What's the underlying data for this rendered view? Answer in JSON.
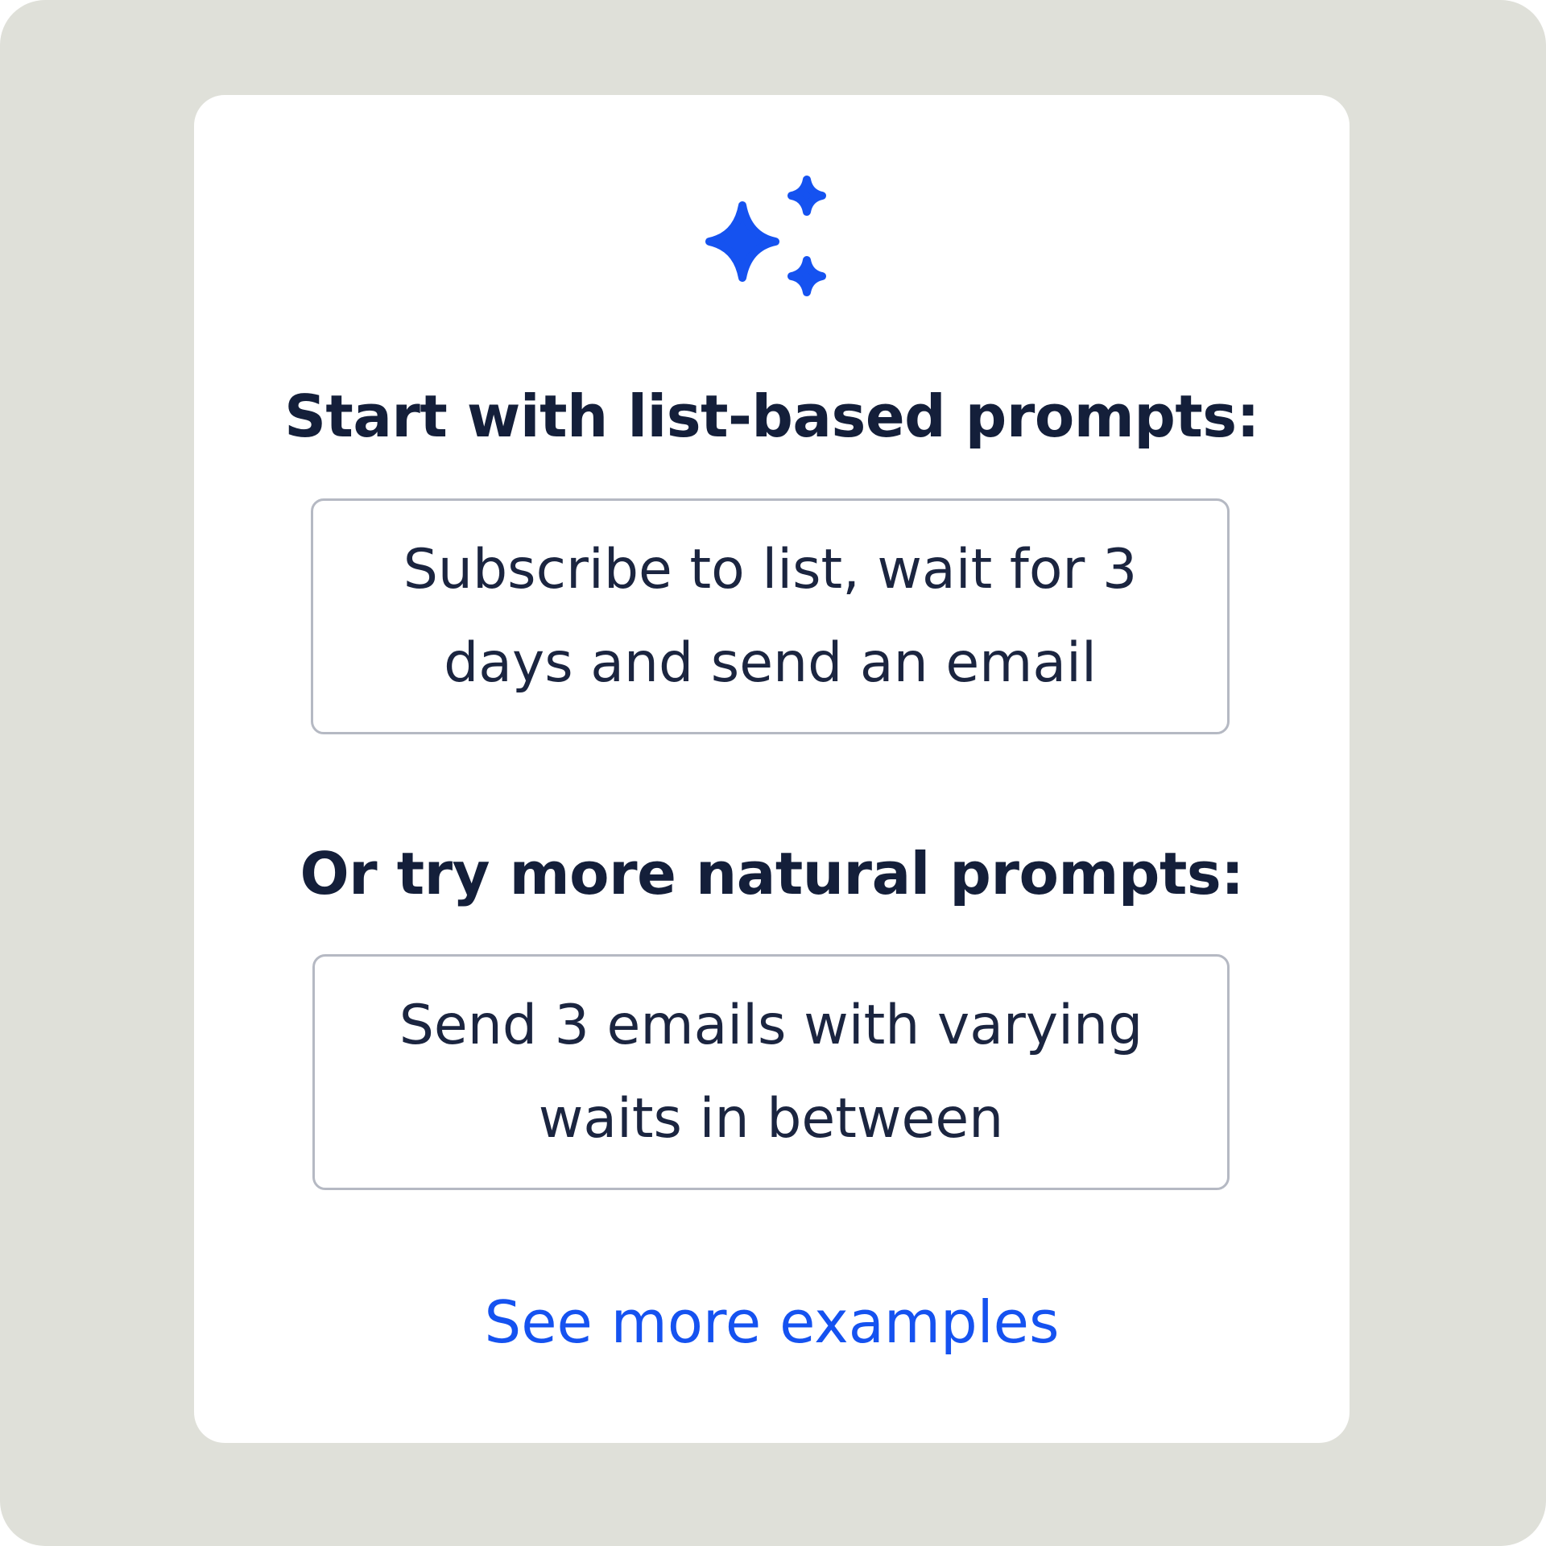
{
  "colors": {
    "background": "#dfe0d9",
    "card": "#ffffff",
    "heading_text": "#141f3a",
    "body_text": "#1b2540",
    "accent": "#1552f0",
    "box_border": "#b5b9c3"
  },
  "icon": "sparkles-icon",
  "section_list": {
    "heading": "Start with list-based prompts:",
    "prompt": "Subscribe to list, wait for 3 days and send an email"
  },
  "section_natural": {
    "heading": "Or try more natural prompts:",
    "prompt": "Send 3 emails with varying waits in between"
  },
  "link": {
    "label": "See more examples"
  }
}
